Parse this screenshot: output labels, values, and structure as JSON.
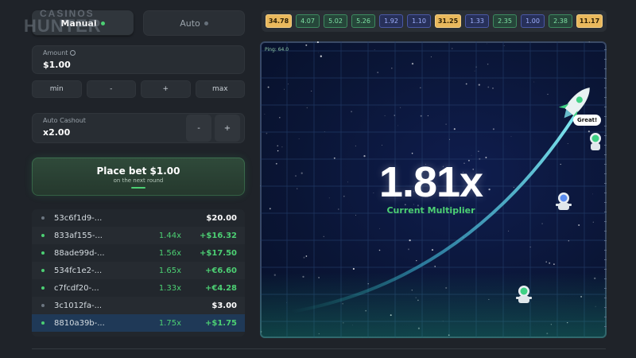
{
  "watermark": {
    "top": "CASINOS",
    "bottom": "HUNTER"
  },
  "tabs": [
    {
      "label": "Manual",
      "active": true
    },
    {
      "label": "Auto",
      "active": false
    }
  ],
  "amount": {
    "label": "Amount",
    "value": "$1.00"
  },
  "quick_buttons": [
    "min",
    "-",
    "+",
    "max"
  ],
  "auto_cashout": {
    "label": "Auto Cashout",
    "value": "x2.00",
    "minus": "-",
    "plus": "+"
  },
  "place_bet": {
    "title": "Place bet $1.00",
    "subtitle": "on the next round"
  },
  "bets": [
    {
      "name": "53c6f1d9-...",
      "multiplier": "",
      "win": "$20.00",
      "status": "pending"
    },
    {
      "name": "833af155-...",
      "multiplier": "1.44x",
      "win": "+$16.32",
      "status": "won"
    },
    {
      "name": "88ade99d-...",
      "multiplier": "1.56x",
      "win": "+$17.50",
      "status": "won"
    },
    {
      "name": "534fc1e2-...",
      "multiplier": "1.65x",
      "win": "+€6.60",
      "status": "won"
    },
    {
      "name": "c7fcdf20-...",
      "multiplier": "1.33x",
      "win": "+€4.28",
      "status": "won"
    },
    {
      "name": "3c1012fa-...",
      "multiplier": "",
      "win": "$3.00",
      "status": "pending"
    },
    {
      "name": "8810a39b-...",
      "multiplier": "1.75x",
      "win": "+$1.75",
      "status": "won",
      "highlight": true
    }
  ],
  "history": [
    {
      "value": "34.78",
      "color": "yellow"
    },
    {
      "value": "4.07",
      "color": "green"
    },
    {
      "value": "5.02",
      "color": "green"
    },
    {
      "value": "5.26",
      "color": "green"
    },
    {
      "value": "1.92",
      "color": "blue"
    },
    {
      "value": "1.10",
      "color": "blue"
    },
    {
      "value": "31.25",
      "color": "yellow"
    },
    {
      "value": "1.33",
      "color": "blue"
    },
    {
      "value": "2.35",
      "color": "green"
    },
    {
      "value": "1.00",
      "color": "blue"
    },
    {
      "value": "2.38",
      "color": "green"
    },
    {
      "value": "11.17",
      "color": "yellow"
    }
  ],
  "game": {
    "ping": "Ping: 64.0",
    "multiplier": "1.81x",
    "multiplier_label": "Current Multiplier",
    "bubble": "Great!"
  },
  "colors": {
    "accent_green": "#4ccf73",
    "highlight_blue": "#1f3957",
    "chip_yellow": "#e9b85c"
  },
  "icons": [
    "rocket-icon",
    "astronaut-icon",
    "info-icon"
  ]
}
